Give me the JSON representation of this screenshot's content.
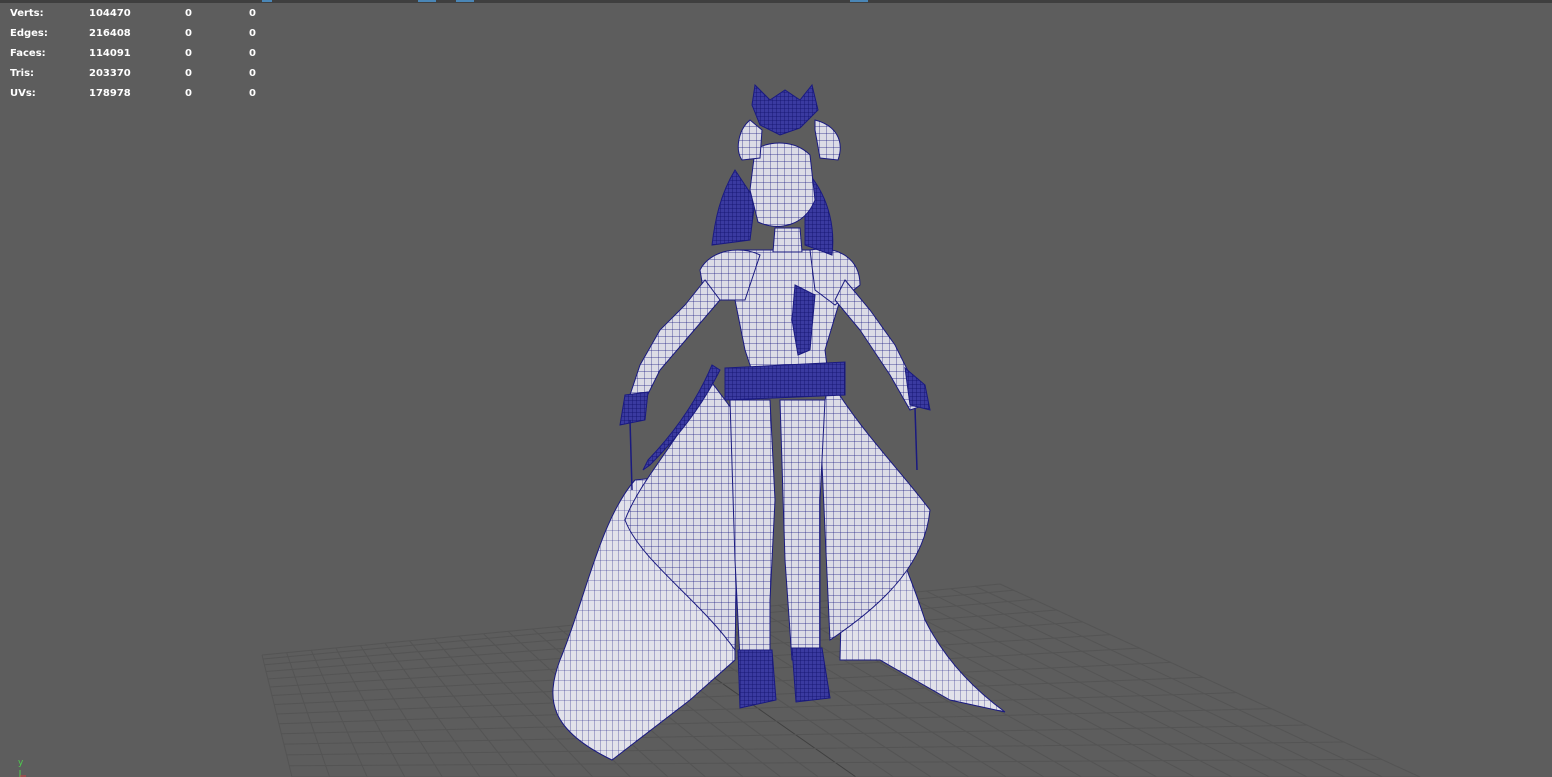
{
  "viewport": {
    "background": "#5d5d5d",
    "grid_color": "#555555",
    "wire_color": "#1a1a80",
    "mesh_fill": "#dcdce6"
  },
  "heads_up_display": {
    "rows": [
      {
        "label": "Verts:",
        "total": "104470",
        "selected": "0",
        "selected_component": "0"
      },
      {
        "label": "Edges:",
        "total": "216408",
        "selected": "0",
        "selected_component": "0"
      },
      {
        "label": "Faces:",
        "total": "114091",
        "selected": "0",
        "selected_component": "0"
      },
      {
        "label": "Tris:",
        "total": "203370",
        "selected": "0",
        "selected_component": "0"
      },
      {
        "label": "UVs:",
        "total": "178978",
        "selected": "0",
        "selected_component": "0"
      }
    ]
  },
  "axis_gizmo": {
    "y_label": "y",
    "y_color": "#4ecb4e",
    "x_color": "#d04040"
  }
}
